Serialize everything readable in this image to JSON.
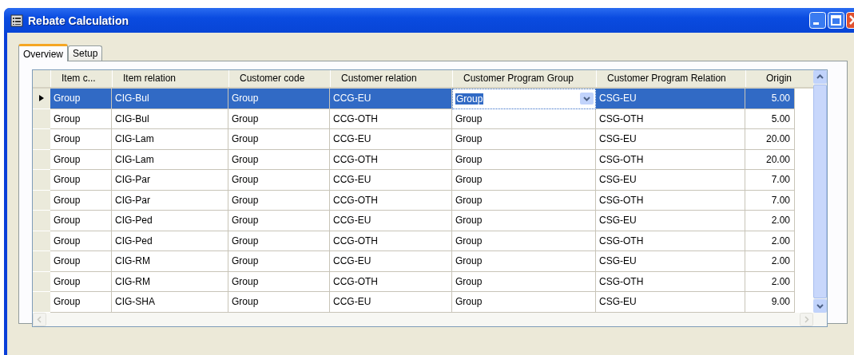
{
  "window": {
    "title": "Rebate Calculation"
  },
  "tabs": [
    {
      "label": "Overview",
      "selected": true
    },
    {
      "label": "Setup",
      "selected": false
    }
  ],
  "table": {
    "columns": [
      {
        "label": "Item c...",
        "kind": "text"
      },
      {
        "label": "Item relation",
        "kind": "text"
      },
      {
        "label": "Customer code",
        "kind": "text"
      },
      {
        "label": "Customer relation",
        "kind": "text"
      },
      {
        "label": "Customer Program Group",
        "kind": "combo"
      },
      {
        "label": "Customer Program Relation",
        "kind": "text"
      },
      {
        "label": "Origin",
        "kind": "number"
      }
    ],
    "rows": [
      {
        "selected": true,
        "current": true,
        "editing": true,
        "cells": [
          "Group",
          "CIG-Bul",
          "Group",
          "CCG-EU",
          "Group",
          "CSG-EU",
          "5.00"
        ]
      },
      {
        "selected": false,
        "current": false,
        "cells": [
          "Group",
          "CIG-Bul",
          "Group",
          "CCG-OTH",
          "Group",
          "CSG-OTH",
          "5.00"
        ]
      },
      {
        "selected": false,
        "current": false,
        "cells": [
          "Group",
          "CIG-Lam",
          "Group",
          "CCG-EU",
          "Group",
          "CSG-EU",
          "20.00"
        ]
      },
      {
        "selected": false,
        "current": false,
        "cells": [
          "Group",
          "CIG-Lam",
          "Group",
          "CCG-OTH",
          "Group",
          "CSG-OTH",
          "20.00"
        ]
      },
      {
        "selected": false,
        "current": false,
        "cells": [
          "Group",
          "CIG-Par",
          "Group",
          "CCG-EU",
          "Group",
          "CSG-EU",
          "7.00"
        ]
      },
      {
        "selected": false,
        "current": false,
        "cells": [
          "Group",
          "CIG-Par",
          "Group",
          "CCG-OTH",
          "Group",
          "CSG-OTH",
          "7.00"
        ]
      },
      {
        "selected": false,
        "current": false,
        "cells": [
          "Group",
          "CIG-Ped",
          "Group",
          "CCG-EU",
          "Group",
          "CSG-EU",
          "2.00"
        ]
      },
      {
        "selected": false,
        "current": false,
        "cells": [
          "Group",
          "CIG-Ped",
          "Group",
          "CCG-OTH",
          "Group",
          "CSG-OTH",
          "2.00"
        ]
      },
      {
        "selected": false,
        "current": false,
        "cells": [
          "Group",
          "CIG-RM",
          "Group",
          "CCG-EU",
          "Group",
          "CSG-EU",
          "2.00"
        ]
      },
      {
        "selected": false,
        "current": false,
        "cells": [
          "Group",
          "CIG-RM",
          "Group",
          "CCG-OTH",
          "Group",
          "CSG-OTH",
          "2.00"
        ]
      },
      {
        "selected": false,
        "current": false,
        "cells": [
          "Group",
          "CIG-SHA",
          "Group",
          "CCG-EU",
          "Group",
          "CSG-EU",
          "9.00"
        ]
      }
    ]
  }
}
